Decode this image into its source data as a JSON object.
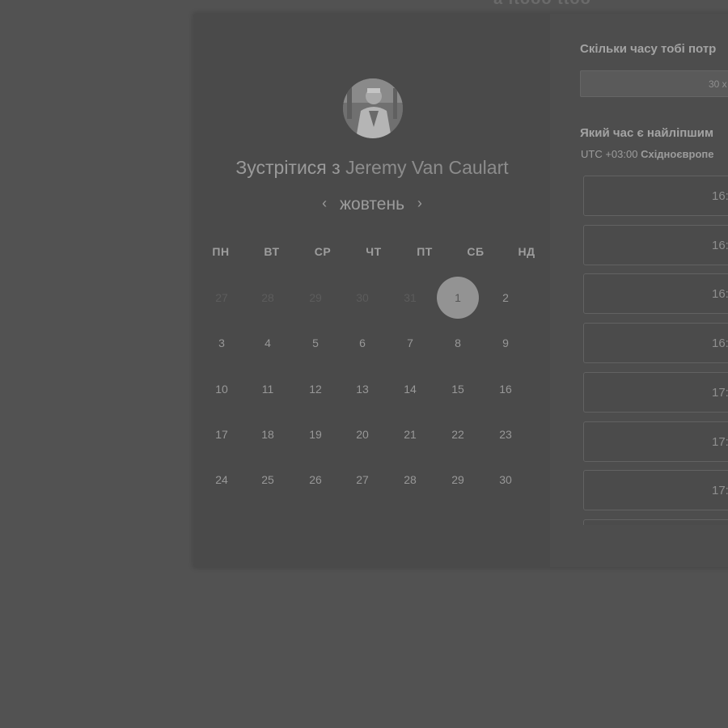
{
  "page": {
    "top_heading_fragment": "a ltooo ttoo"
  },
  "profile": {
    "meet_prefix": "Зустрітися з",
    "host_name": "Jeremy Van Caulart"
  },
  "calendar": {
    "prev_icon": "‹",
    "next_icon": "›",
    "month": "жовтень",
    "weekdays": [
      "ПН",
      "ВТ",
      "СР",
      "ЧТ",
      "ПТ",
      "СБ",
      "НД"
    ],
    "weeks": [
      [
        {
          "d": "27",
          "muted": true
        },
        {
          "d": "28",
          "muted": true
        },
        {
          "d": "29",
          "muted": true
        },
        {
          "d": "30",
          "muted": true
        },
        {
          "d": "31",
          "muted": true
        },
        {
          "d": "1",
          "selected": true
        },
        {
          "d": "2"
        }
      ],
      [
        {
          "d": "3"
        },
        {
          "d": "4"
        },
        {
          "d": "5"
        },
        {
          "d": "6"
        },
        {
          "d": "7"
        },
        {
          "d": "8"
        },
        {
          "d": "9"
        }
      ],
      [
        {
          "d": "10"
        },
        {
          "d": "11"
        },
        {
          "d": "12"
        },
        {
          "d": "13"
        },
        {
          "d": "14"
        },
        {
          "d": "15"
        },
        {
          "d": "16"
        }
      ],
      [
        {
          "d": "17"
        },
        {
          "d": "18"
        },
        {
          "d": "19"
        },
        {
          "d": "20"
        },
        {
          "d": "21"
        },
        {
          "d": "22"
        },
        {
          "d": "23"
        }
      ],
      [
        {
          "d": "24"
        },
        {
          "d": "25"
        },
        {
          "d": "26"
        },
        {
          "d": "27"
        },
        {
          "d": "28"
        },
        {
          "d": "29"
        },
        {
          "d": "30"
        }
      ]
    ]
  },
  "booking": {
    "duration_question": "Скільки часу тобі потр",
    "duration_value": "30 х",
    "time_question": "Який час є найліпшим",
    "timezone_offset": "UTC +03:00",
    "timezone_name": "Східноєвропе",
    "slots": [
      "16:",
      "16:",
      "16:",
      "16:",
      "17:",
      "17:",
      "17:",
      ""
    ]
  },
  "colors": {
    "background": "#525252",
    "panel": "#4a4a4a",
    "selected_day": "#939393"
  }
}
